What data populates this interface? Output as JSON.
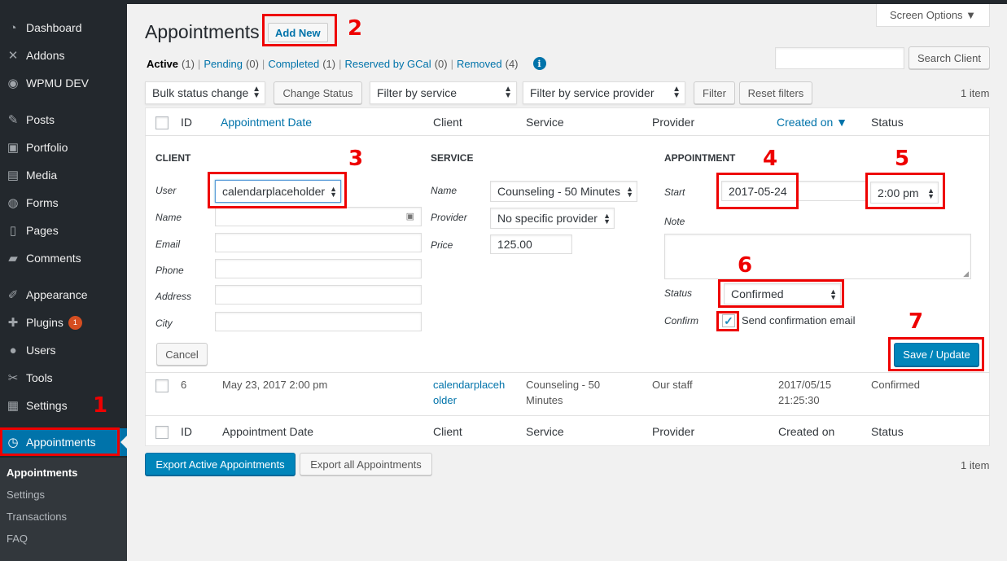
{
  "sidebar": {
    "items": [
      {
        "label": "Dashboard",
        "icon": "dashboard-icon",
        "glyph": "◔"
      },
      {
        "label": "Addons",
        "icon": "addons-icon",
        "glyph": "✕"
      },
      {
        "label": "WPMU DEV",
        "icon": "wpmudev-icon",
        "glyph": "◉"
      },
      {
        "label": "Posts",
        "icon": "pin-icon",
        "glyph": "✎"
      },
      {
        "label": "Portfolio",
        "icon": "portfolio-icon",
        "glyph": "▣"
      },
      {
        "label": "Media",
        "icon": "media-icon",
        "glyph": "▤"
      },
      {
        "label": "Forms",
        "icon": "forms-icon",
        "glyph": "◍"
      },
      {
        "label": "Pages",
        "icon": "pages-icon",
        "glyph": "▯"
      },
      {
        "label": "Comments",
        "icon": "comments-icon",
        "glyph": "▰"
      },
      {
        "label": "Appearance",
        "icon": "appearance-icon",
        "glyph": "✐"
      },
      {
        "label": "Plugins",
        "icon": "plugins-icon",
        "glyph": "✚",
        "badge": "1"
      },
      {
        "label": "Users",
        "icon": "users-icon",
        "glyph": "●"
      },
      {
        "label": "Tools",
        "icon": "tools-icon",
        "glyph": "✂"
      },
      {
        "label": "Settings",
        "icon": "settings-icon",
        "glyph": "▦"
      },
      {
        "label": "Appointments",
        "icon": "clock-icon",
        "glyph": "◷"
      }
    ],
    "submenu": [
      "Appointments",
      "Settings",
      "Transactions",
      "FAQ"
    ]
  },
  "header": {
    "screen_options": "Screen Options ▼",
    "title": "Appointments",
    "add_new": "Add New"
  },
  "views": [
    {
      "label": "Active",
      "count": "(1)"
    },
    {
      "label": "Pending",
      "count": "(0)"
    },
    {
      "label": "Completed",
      "count": "(1)"
    },
    {
      "label": "Reserved by GCal",
      "count": "(0)"
    },
    {
      "label": "Removed",
      "count": "(4)"
    }
  ],
  "search": {
    "placeholder": "",
    "button": "Search Client"
  },
  "toolbar": {
    "bulk": "Bulk status change",
    "change_status": "Change Status",
    "filter_service": "Filter by service",
    "filter_provider": "Filter by service provider",
    "filter": "Filter",
    "reset": "Reset filters",
    "items": "1 item"
  },
  "table": {
    "headers": [
      "ID",
      "Appointment Date",
      "Client",
      "Service",
      "Provider",
      "Created on ▼",
      "Status"
    ],
    "footer_headers": [
      "ID",
      "Appointment Date",
      "Client",
      "Service",
      "Provider",
      "Created on",
      "Status"
    ],
    "row": {
      "id": "6",
      "date": "May 23, 2017 2:00 pm",
      "client_line1": "calendarplaceh",
      "client_line2": "older",
      "service_line1": "Counseling - 50",
      "service_line2": "Minutes",
      "provider": "Our staff",
      "created_line1": "2017/05/15",
      "created_line2": "21:25:30",
      "status": "Confirmed"
    }
  },
  "edit": {
    "client_title": "CLIENT",
    "service_title": "SERVICE",
    "appointment_title": "APPOINTMENT",
    "labels": {
      "user": "User",
      "name": "Name",
      "email": "Email",
      "phone": "Phone",
      "address": "Address",
      "city": "City",
      "service_name": "Name",
      "provider": "Provider",
      "price": "Price",
      "start": "Start",
      "note": "Note",
      "status": "Status",
      "confirm": "Confirm"
    },
    "user_value": "calendarplaceholder",
    "service_value": "Counseling - 50 Minutes",
    "provider_value": "No specific provider",
    "price_value": "125.00",
    "start_date": "2017-05-24",
    "start_time": "2:00 pm",
    "status_value": "Confirmed",
    "confirm_text": "Send confirmation email",
    "cancel": "Cancel",
    "save": "Save / Update"
  },
  "export": {
    "active": "Export Active Appointments",
    "all": "Export all Appointments",
    "items": "1 item"
  },
  "annotations": [
    "1",
    "2",
    "3",
    "4",
    "5",
    "6",
    "7"
  ]
}
